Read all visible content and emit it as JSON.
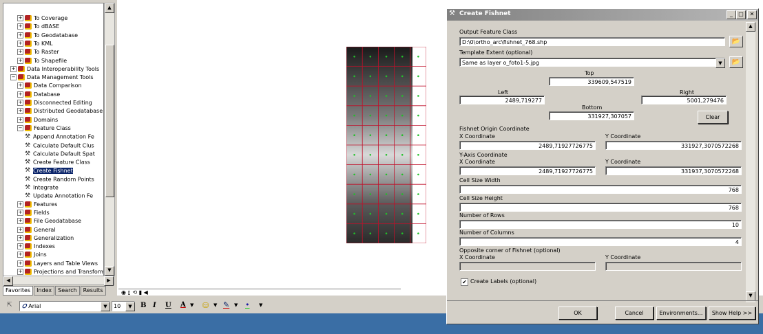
{
  "toolbox": {
    "items": [
      {
        "label": "To Coverage",
        "kind": "toolset",
        "indent": 2
      },
      {
        "label": "To dBASE",
        "kind": "toolset",
        "indent": 2
      },
      {
        "label": "To Geodatabase",
        "kind": "toolset",
        "indent": 2
      },
      {
        "label": "To KML",
        "kind": "toolset",
        "indent": 2
      },
      {
        "label": "To Raster",
        "kind": "toolset",
        "indent": 2
      },
      {
        "label": "To Shapefile",
        "kind": "toolset",
        "indent": 2
      },
      {
        "label": "Data Interoperability Tools",
        "kind": "toolbox",
        "indent": 1
      },
      {
        "label": "Data Management Tools",
        "kind": "toolbox",
        "indent": 1
      },
      {
        "label": "Data Comparison",
        "kind": "toolset",
        "indent": 2
      },
      {
        "label": "Database",
        "kind": "toolset",
        "indent": 2
      },
      {
        "label": "Disconnected Editing",
        "kind": "toolset",
        "indent": 2
      },
      {
        "label": "Distributed Geodatabase",
        "kind": "toolset",
        "indent": 2
      },
      {
        "label": "Domains",
        "kind": "toolset",
        "indent": 2
      },
      {
        "label": "Feature Class",
        "kind": "toolset",
        "indent": 2
      },
      {
        "label": "Append Annotation Fe",
        "kind": "tool",
        "indent": 3
      },
      {
        "label": "Calculate Default Clus",
        "kind": "tool",
        "indent": 3
      },
      {
        "label": "Calculate Default Spat",
        "kind": "tool",
        "indent": 3
      },
      {
        "label": "Create Feature Class",
        "kind": "tool",
        "indent": 3
      },
      {
        "label": "Create Fishnet",
        "kind": "tool",
        "indent": 3,
        "selected": true
      },
      {
        "label": "Create Random Points",
        "kind": "tool",
        "indent": 3
      },
      {
        "label": "Integrate",
        "kind": "tool",
        "indent": 3
      },
      {
        "label": "Update Annotation Fe",
        "kind": "tool",
        "indent": 3
      },
      {
        "label": "Features",
        "kind": "toolset",
        "indent": 2
      },
      {
        "label": "Fields",
        "kind": "toolset",
        "indent": 2
      },
      {
        "label": "File Geodatabase",
        "kind": "toolset",
        "indent": 2
      },
      {
        "label": "General",
        "kind": "toolset",
        "indent": 2
      },
      {
        "label": "Generalization",
        "kind": "toolset",
        "indent": 2
      },
      {
        "label": "Indexes",
        "kind": "toolset",
        "indent": 2
      },
      {
        "label": "Joins",
        "kind": "toolset",
        "indent": 2
      },
      {
        "label": "Layers and Table Views",
        "kind": "toolset",
        "indent": 2
      },
      {
        "label": "Projections and Transform",
        "kind": "toolset",
        "indent": 2
      }
    ],
    "tabs": [
      "Favorites",
      "Index",
      "Search",
      "Results"
    ]
  },
  "drawing_toolbar": {
    "font_name": "Arial",
    "font_size": "10",
    "bold": "B",
    "italic": "I",
    "underline": "U",
    "font_color_glyph": "A"
  },
  "dialog": {
    "title": "Create Fishnet",
    "output_label": "Output Feature Class",
    "output_value": "D:\\0\\ortho_arc\\fishnet_768.shp",
    "template_label": "Template Extent (optional)",
    "template_value": "Same as layer o_foto1-5.jpg",
    "top_label": "Top",
    "top_value": "339609,547519",
    "left_label": "Left",
    "left_value": "2489,719277",
    "right_label": "Right",
    "right_value": "5001,279476",
    "bottom_label": "Bottom",
    "bottom_value": "331927,307057",
    "clear_label": "Clear",
    "origin_label": "Fishnet Origin Coordinate",
    "origin_x_label": "X Coordinate",
    "origin_x_value": "2489,71927726775",
    "origin_y_label": "Y Coordinate",
    "origin_y_value": "331927,3070572268",
    "yaxis_label": "Y-Axis Coordinate",
    "yaxis_x_label": "X Coordinate",
    "yaxis_x_value": "2489,71927726775",
    "yaxis_y_label": "Y Coordinate",
    "yaxis_y_value": "331937,3070572268",
    "cell_width_label": "Cell Size Width",
    "cell_width_value": "768",
    "cell_height_label": "Cell Size Height",
    "cell_height_value": "768",
    "rows_label": "Number of Rows",
    "rows_value": "10",
    "cols_label": "Number of Columns",
    "cols_value": "4",
    "opposite_label": "Opposite corner of Fishnet (optional)",
    "opp_x_label": "X Coordinate",
    "opp_y_label": "Y Coordinate",
    "labels_checkbox": "Create Labels (optional)",
    "labels_checked": true,
    "ok": "OK",
    "cancel": "Cancel",
    "environments": "Environments...",
    "show_help": "Show Help >>"
  },
  "colors": {
    "grid_line": "#c0102a",
    "point": "#22c02a",
    "title_bar": "#808080",
    "selection": "#0a246a"
  }
}
